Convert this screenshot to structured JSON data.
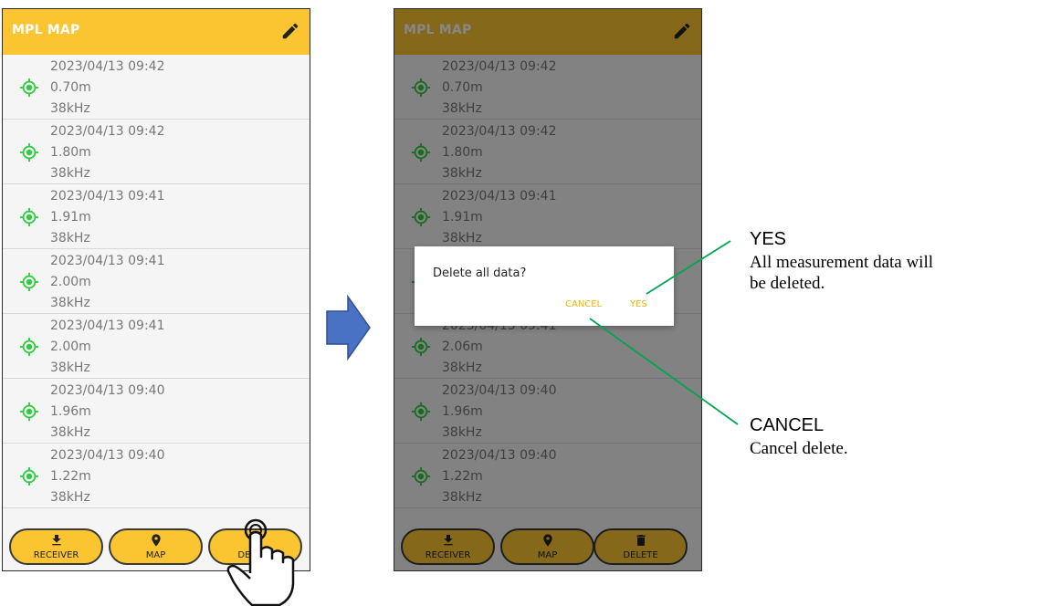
{
  "app": {
    "title": "MPL MAP"
  },
  "icons": {
    "edit": "pencil-icon",
    "location": "gps-target-icon",
    "receiver": "download-icon",
    "map": "map-pin-icon",
    "delete": "trash-icon"
  },
  "colors": {
    "appbar": "#fbc531",
    "location_icon": "#2ecc40",
    "dialog_button": "#f0b400",
    "callout_line": "#00a651",
    "arrow": "#4a72c4"
  },
  "records_left": [
    {
      "date": "2023/04/13 09:42",
      "depth": "0.70m",
      "freq": "38kHz"
    },
    {
      "date": "2023/04/13 09:42",
      "depth": "1.80m",
      "freq": "38kHz"
    },
    {
      "date": "2023/04/13 09:41",
      "depth": "1.91m",
      "freq": "38kHz"
    },
    {
      "date": "2023/04/13 09:41",
      "depth": "2.00m",
      "freq": "38kHz"
    },
    {
      "date": "2023/04/13 09:41",
      "depth": "2.00m",
      "freq": "38kHz"
    },
    {
      "date": "2023/04/13 09:40",
      "depth": "1.96m",
      "freq": "38kHz"
    },
    {
      "date": "2023/04/13 09:40",
      "depth": "1.22m",
      "freq": "38kHz"
    }
  ],
  "records_right": [
    {
      "date": "2023/04/13 09:42",
      "depth": "0.70m",
      "freq": "38kHz"
    },
    {
      "date": "2023/04/13 09:42",
      "depth": "1.80m",
      "freq": "38kHz"
    },
    {
      "date": "2023/04/13 09:41",
      "depth": "1.91m",
      "freq": "38kHz"
    },
    {
      "date": "",
      "depth": "",
      "freq": ""
    },
    {
      "date": "2023/04/13 09:41",
      "depth": "2.06m",
      "freq": "38kHz"
    },
    {
      "date": "2023/04/13 09:40",
      "depth": "1.96m",
      "freq": "38kHz"
    },
    {
      "date": "2023/04/13 09:40",
      "depth": "1.22m",
      "freq": "38kHz"
    }
  ],
  "bottom": {
    "receiver": "RECEIVER",
    "map": "MAP",
    "delete": "DELETE"
  },
  "dialog": {
    "message": "Delete all data?",
    "cancel": "CANCEL",
    "yes": "YES"
  },
  "annotations": {
    "yes_title": "YES",
    "yes_desc_1": "All measurement data will",
    "yes_desc_2": "be deleted.",
    "cancel_title": "CANCEL",
    "cancel_desc": "Cancel delete."
  }
}
